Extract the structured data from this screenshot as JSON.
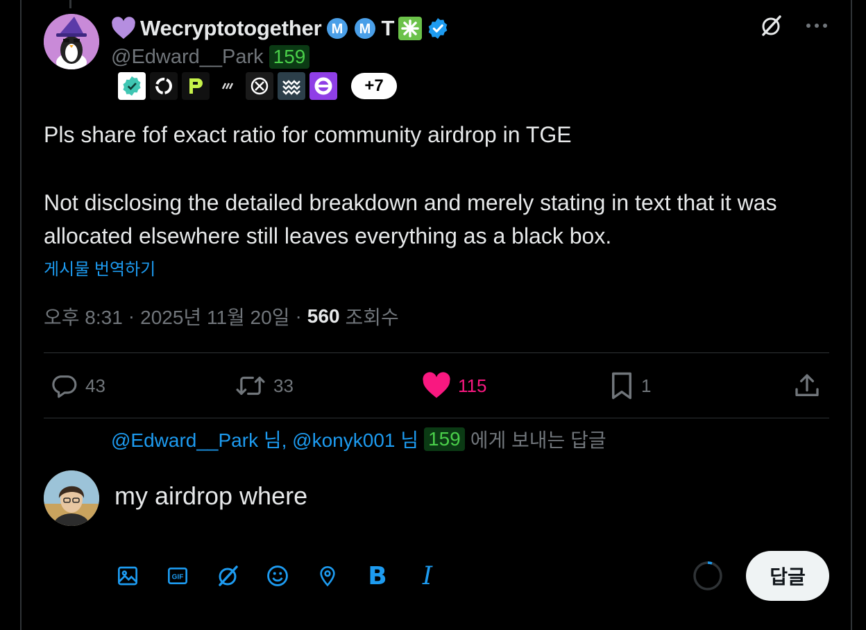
{
  "tweet": {
    "author": {
      "display_name": "Wecryptotogether",
      "name_suffix": "T",
      "handle": "@Edward__Park",
      "handle_badge": "159",
      "more_badges_label": "+7",
      "badge_icons": [
        "verified-badge-icon",
        "ring-logo-icon",
        "p-logo-icon",
        "tick-logo-icon",
        "x-circle-logo-icon",
        "waves-logo-icon",
        "purple-ring-logo-icon"
      ]
    },
    "text_line1": "Pls share fof exact ratio for community airdrop in TGE",
    "text_line2": "Not disclosing the detailed breakdown and merely stating in text that it was allocated elsewhere still leaves everything as a black box.",
    "translate_label": "게시물 번역하기",
    "meta": {
      "time": "오후 8:31",
      "sep1": "·",
      "date": "2025년 11월 20일",
      "sep2": "·",
      "views_count": "560",
      "views_label": "조회수"
    },
    "actions": {
      "replies": "43",
      "reposts": "33",
      "likes": "115",
      "bookmarks": "1"
    }
  },
  "reply_compose": {
    "replying_handles": "@Edward__Park 님, @konyk001 님",
    "replying_badge": "159",
    "replying_suffix": "에게 보내는 답글",
    "text": "my airdrop where",
    "toolbar": [
      "image-icon",
      "gif-icon",
      "grok-icon",
      "emoji-icon",
      "location-icon",
      "bold-icon",
      "italic-icon"
    ],
    "bold_label": "B",
    "italic_label": "I",
    "submit_label": "답글"
  },
  "colors": {
    "accent": "#1d9bf0",
    "like": "#f91880",
    "muted": "#71767b",
    "badge_green": "#4ad04a"
  }
}
